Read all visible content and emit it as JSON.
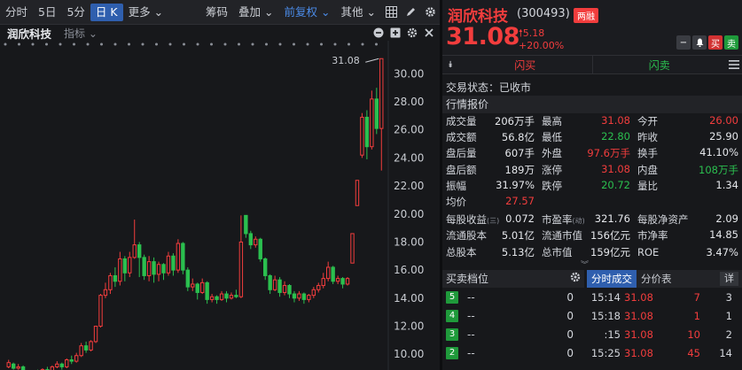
{
  "toolbar": {
    "items": [
      "分时",
      "5日",
      "5分",
      "日 K",
      "更多"
    ],
    "right_items": [
      "筹码",
      "叠加",
      "前复权",
      "其他"
    ]
  },
  "chart_header": {
    "stock_name": "润欣科技",
    "indicator_label": "指标"
  },
  "chart_data": {
    "type": "candlestick",
    "y_ticks": [
      "30.00",
      "28.00",
      "26.00",
      "24.00",
      "22.00",
      "20.00",
      "18.00",
      "16.00",
      "14.00",
      "12.00",
      "10.00"
    ],
    "ylim": [
      9.0,
      31.6
    ],
    "high_label": "31.08",
    "low_label": "8.04",
    "candles": [
      {
        "o": 9.1,
        "c": 9.4,
        "h": 9.6,
        "l": 9.0
      },
      {
        "o": 9.3,
        "c": 9.0,
        "h": 9.4,
        "l": 8.9
      },
      {
        "o": 9.0,
        "c": 9.1,
        "h": 9.3,
        "l": 8.9
      },
      {
        "o": 9.1,
        "c": 8.6,
        "h": 9.2,
        "l": 8.5
      },
      {
        "o": 8.6,
        "c": 8.2,
        "h": 8.7,
        "l": 8.04
      },
      {
        "o": 8.2,
        "c": 8.6,
        "h": 8.7,
        "l": 8.1
      },
      {
        "o": 8.6,
        "c": 8.5,
        "h": 8.9,
        "l": 8.3
      },
      {
        "o": 8.5,
        "c": 8.9,
        "h": 9.0,
        "l": 8.4
      },
      {
        "o": 8.9,
        "c": 8.8,
        "h": 9.1,
        "l": 8.6
      },
      {
        "o": 8.8,
        "c": 9.1,
        "h": 9.2,
        "l": 8.7
      },
      {
        "o": 9.1,
        "c": 9.3,
        "h": 9.5,
        "l": 9.0
      },
      {
        "o": 9.3,
        "c": 9.1,
        "h": 9.4,
        "l": 8.9
      },
      {
        "o": 9.1,
        "c": 9.6,
        "h": 9.7,
        "l": 9.0
      },
      {
        "o": 9.6,
        "c": 9.5,
        "h": 9.9,
        "l": 9.3
      },
      {
        "o": 9.5,
        "c": 9.9,
        "h": 10.1,
        "l": 9.4
      },
      {
        "o": 9.9,
        "c": 10.6,
        "h": 10.8,
        "l": 9.8
      },
      {
        "o": 10.6,
        "c": 10.3,
        "h": 10.9,
        "l": 10.1
      },
      {
        "o": 10.3,
        "c": 10.9,
        "h": 11.0,
        "l": 10.2
      },
      {
        "o": 10.9,
        "c": 12.0,
        "h": 12.0,
        "l": 10.8
      },
      {
        "o": 12.0,
        "c": 14.2,
        "h": 14.3,
        "l": 11.9
      },
      {
        "o": 14.2,
        "c": 14.6,
        "h": 15.1,
        "l": 14.0
      },
      {
        "o": 14.6,
        "c": 15.6,
        "h": 15.8,
        "l": 14.3
      },
      {
        "o": 15.6,
        "c": 15.2,
        "h": 16.2,
        "l": 14.8
      },
      {
        "o": 15.2,
        "c": 16.8,
        "h": 17.3,
        "l": 14.9
      },
      {
        "o": 16.8,
        "c": 15.8,
        "h": 17.0,
        "l": 15.2
      },
      {
        "o": 15.8,
        "c": 16.9,
        "h": 17.3,
        "l": 15.5
      },
      {
        "o": 16.9,
        "c": 17.8,
        "h": 19.6,
        "l": 16.8
      },
      {
        "o": 17.8,
        "c": 16.9,
        "h": 18.0,
        "l": 15.5
      },
      {
        "o": 16.9,
        "c": 15.6,
        "h": 17.1,
        "l": 15.3
      },
      {
        "o": 15.6,
        "c": 16.6,
        "h": 17.0,
        "l": 15.2
      },
      {
        "o": 16.6,
        "c": 15.7,
        "h": 16.9,
        "l": 15.1
      },
      {
        "o": 15.7,
        "c": 16.4,
        "h": 16.6,
        "l": 15.2
      },
      {
        "o": 16.4,
        "c": 15.8,
        "h": 16.5,
        "l": 15.3
      },
      {
        "o": 15.8,
        "c": 17.0,
        "h": 17.3,
        "l": 15.6
      },
      {
        "o": 17.0,
        "c": 16.0,
        "h": 17.2,
        "l": 15.6
      },
      {
        "o": 16.0,
        "c": 17.9,
        "h": 18.2,
        "l": 15.8
      },
      {
        "o": 17.9,
        "c": 16.0,
        "h": 18.0,
        "l": 15.7
      },
      {
        "o": 16.0,
        "c": 14.8,
        "h": 16.2,
        "l": 14.5
      },
      {
        "o": 14.8,
        "c": 15.0,
        "h": 15.4,
        "l": 14.5
      },
      {
        "o": 15.0,
        "c": 14.4,
        "h": 15.1,
        "l": 13.9
      },
      {
        "o": 14.4,
        "c": 15.1,
        "h": 15.4,
        "l": 14.3
      },
      {
        "o": 15.1,
        "c": 13.9,
        "h": 15.2,
        "l": 13.6
      },
      {
        "o": 13.9,
        "c": 14.1,
        "h": 14.3,
        "l": 13.7
      },
      {
        "o": 14.1,
        "c": 13.9,
        "h": 14.2,
        "l": 13.6
      },
      {
        "o": 13.9,
        "c": 14.3,
        "h": 14.5,
        "l": 13.8
      },
      {
        "o": 14.3,
        "c": 14.0,
        "h": 14.5,
        "l": 13.7
      },
      {
        "o": 14.0,
        "c": 14.2,
        "h": 14.4,
        "l": 13.9
      },
      {
        "o": 14.2,
        "c": 14.1,
        "h": 14.6,
        "l": 14.0
      },
      {
        "o": 14.1,
        "c": 18.0,
        "h": 19.9,
        "l": 14.0
      },
      {
        "o": 19.9,
        "c": 18.6,
        "h": 19.9,
        "l": 18.3
      },
      {
        "o": 18.6,
        "c": 17.8,
        "h": 18.8,
        "l": 17.5
      },
      {
        "o": 17.8,
        "c": 18.2,
        "h": 18.4,
        "l": 17.6
      },
      {
        "o": 18.2,
        "c": 16.8,
        "h": 18.3,
        "l": 16.6
      },
      {
        "o": 16.8,
        "c": 15.6,
        "h": 16.9,
        "l": 15.3
      },
      {
        "o": 15.6,
        "c": 14.6,
        "h": 15.7,
        "l": 14.3
      },
      {
        "o": 14.6,
        "c": 15.3,
        "h": 15.6,
        "l": 14.5
      },
      {
        "o": 15.3,
        "c": 14.4,
        "h": 15.5,
        "l": 14.1
      },
      {
        "o": 14.4,
        "c": 14.9,
        "h": 15.2,
        "l": 14.2
      },
      {
        "o": 14.9,
        "c": 14.3,
        "h": 15.0,
        "l": 14.0
      },
      {
        "o": 14.3,
        "c": 14.0,
        "h": 14.5,
        "l": 13.7
      },
      {
        "o": 14.0,
        "c": 14.3,
        "h": 14.5,
        "l": 13.8
      },
      {
        "o": 14.3,
        "c": 13.9,
        "h": 14.4,
        "l": 13.6
      },
      {
        "o": 13.9,
        "c": 14.2,
        "h": 14.3,
        "l": 13.7
      },
      {
        "o": 14.2,
        "c": 14.6,
        "h": 14.8,
        "l": 14.0
      },
      {
        "o": 14.6,
        "c": 14.9,
        "h": 15.1,
        "l": 14.4
      },
      {
        "o": 14.9,
        "c": 15.4,
        "h": 15.8,
        "l": 14.7
      },
      {
        "o": 15.4,
        "c": 16.2,
        "h": 16.6,
        "l": 15.2
      },
      {
        "o": 16.2,
        "c": 15.2,
        "h": 16.3,
        "l": 15.0
      },
      {
        "o": 15.2,
        "c": 15.4,
        "h": 15.6,
        "l": 15.0
      },
      {
        "o": 15.4,
        "c": 15.0,
        "h": 15.5,
        "l": 14.7
      },
      {
        "o": 15.0,
        "c": 15.4,
        "h": 15.5,
        "l": 14.9
      },
      {
        "o": 16.5,
        "c": 18.6,
        "h": 18.6,
        "l": 16.5
      },
      {
        "o": 20.6,
        "c": 22.4,
        "h": 22.4,
        "l": 20.6
      },
      {
        "o": 24.2,
        "c": 26.9,
        "h": 27.2,
        "l": 24.0
      },
      {
        "o": 26.9,
        "c": 24.8,
        "h": 27.4,
        "l": 23.9
      },
      {
        "o": 24.8,
        "c": 28.2,
        "h": 28.8,
        "l": 24.6
      },
      {
        "o": 28.2,
        "c": 26.1,
        "h": 29.0,
        "l": 25.7
      },
      {
        "o": 26.1,
        "c": 31.08,
        "h": 31.08,
        "l": 23.1
      }
    ]
  },
  "quote": {
    "name": "润欣科技",
    "code": "(300493)",
    "badge": "两融",
    "price": "31.08",
    "change": "5.18",
    "change_pct": "+20.00%",
    "buy_label": "闪买",
    "sell_label": "闪卖",
    "btn_buy": "买",
    "btn_sell": "卖",
    "status": "交易状态：已收市",
    "section_title": "行情报价",
    "rows": [
      [
        [
          "成交量",
          "206万手",
          "w"
        ],
        [
          "最高",
          "31.08",
          "r"
        ],
        [
          "今开",
          "26.00",
          "r"
        ]
      ],
      [
        [
          "成交额",
          "56.8亿",
          "w"
        ],
        [
          "最低",
          "22.80",
          "g"
        ],
        [
          "昨收",
          "25.90",
          "w"
        ]
      ],
      [
        [
          "盘后量",
          "607手",
          "w"
        ],
        [
          "外盘",
          "97.6万手",
          "r"
        ],
        [
          "换手",
          "41.10%",
          "w"
        ]
      ],
      [
        [
          "盘后额",
          "189万",
          "w"
        ],
        [
          "涨停",
          "31.08",
          "r"
        ],
        [
          "内盘",
          "108万手",
          "g"
        ]
      ],
      [
        [
          "振幅",
          "31.97%",
          "w"
        ],
        [
          "跌停",
          "20.72",
          "g"
        ],
        [
          "量比",
          "1.34",
          "w"
        ]
      ],
      [
        [
          "均价",
          "27.57",
          "r"
        ],
        [
          "",
          "",
          " "
        ],
        [
          "",
          "",
          " "
        ]
      ],
      [
        [
          "每股收益",
          "0.072",
          "w"
        ],
        [
          "市盈率",
          "321.76",
          "w"
        ],
        [
          "每股净资产",
          "2.09",
          "w"
        ]
      ],
      [
        [
          "流通股本",
          "5.01亿",
          "w"
        ],
        [
          "流通市值",
          "156亿元",
          "w"
        ],
        [
          "市净率",
          "14.85",
          "w"
        ]
      ],
      [
        [
          "总股本",
          "5.13亿",
          "w"
        ],
        [
          "总市值",
          "159亿元",
          "w"
        ],
        [
          "ROE",
          "3.47%",
          "w"
        ]
      ]
    ],
    "sub_label_eps": "(三)",
    "sub_label_pe": "(动)"
  },
  "orderbook": {
    "title": "买卖档位",
    "rows": [
      {
        "n": "5",
        "p": "--",
        "v": "0"
      },
      {
        "n": "4",
        "p": "--",
        "v": "0"
      },
      {
        "n": "3",
        "p": "--",
        "v": "0"
      },
      {
        "n": "2",
        "p": "--",
        "v": "0"
      }
    ]
  },
  "trades": {
    "tabs": [
      "分时成交",
      "分价表"
    ],
    "detail": "详",
    "rows": [
      {
        "t": "15:14",
        "p": "31.08",
        "v": "7",
        "n": "3"
      },
      {
        "t": "15:18",
        "p": "31.08",
        "v": "1",
        "n": "1"
      },
      {
        "t": ":15",
        "p": "31.08",
        "v": "10",
        "n": "2"
      },
      {
        "t": "15:25",
        "p": "31.08",
        "v": "45",
        "n": "14"
      }
    ]
  },
  "colors": {
    "up": "#f23d3d",
    "down": "#2bbf4f",
    "accent": "#2f5fae"
  }
}
